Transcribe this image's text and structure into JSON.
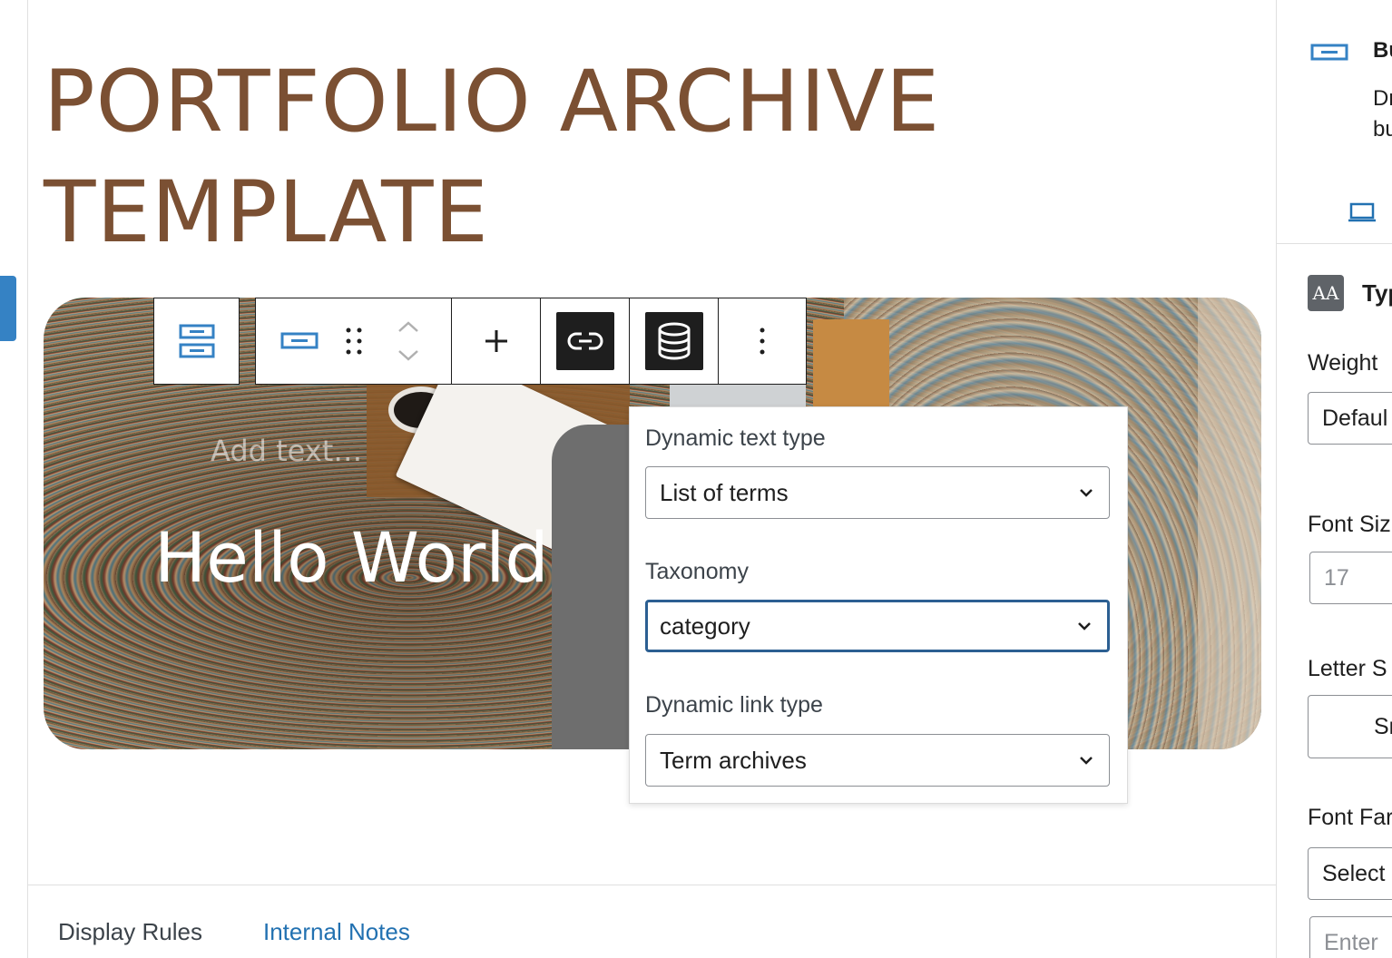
{
  "page": {
    "title_line1": "PORTFOLIO ARCHIVE",
    "title_line2": "TEMPLATE"
  },
  "hero": {
    "placeholder_text": "Add text…",
    "heading": "Hello World"
  },
  "toolbar": {
    "parent_icon": "parent-block-icon",
    "block_icon": "button-block-icon",
    "drag_icon": "drag-handle-icon",
    "move_icon": "move-up-down-icon",
    "add_icon": "plus-icon",
    "link_icon": "dynamic-link-icon",
    "data_icon": "database-icon",
    "more_icon": "more-options-icon"
  },
  "popover": {
    "dynamic_text_type": {
      "label": "Dynamic text type",
      "value": "List of terms"
    },
    "taxonomy": {
      "label": "Taxonomy",
      "value": "category"
    },
    "dynamic_link_type": {
      "label": "Dynamic link type",
      "value": "Term archives"
    }
  },
  "bottom_tabs": [
    {
      "label": "Display Rules"
    },
    {
      "label": "Internal Notes"
    }
  ],
  "sidebar": {
    "block": {
      "title": "Bu",
      "desc_line1": "Dr",
      "desc_line2": "bu"
    },
    "typography": {
      "title": "Typ",
      "icon_glyph": "AA",
      "weight": {
        "label": "Weight",
        "value": "Defaul"
      },
      "font_size": {
        "label": "Font Siz",
        "value": "17"
      },
      "letter_spacing": {
        "label": "Letter S",
        "value": "Sma"
      },
      "font_family": {
        "label": "Font Far",
        "value": "Select",
        "input_placeholder": "Enter"
      }
    }
  },
  "colors": {
    "title_brown": "#7b5033",
    "accent_blue": "#2271b1",
    "focus_blue": "#2c5f92",
    "dark": "#1e1e1e"
  }
}
